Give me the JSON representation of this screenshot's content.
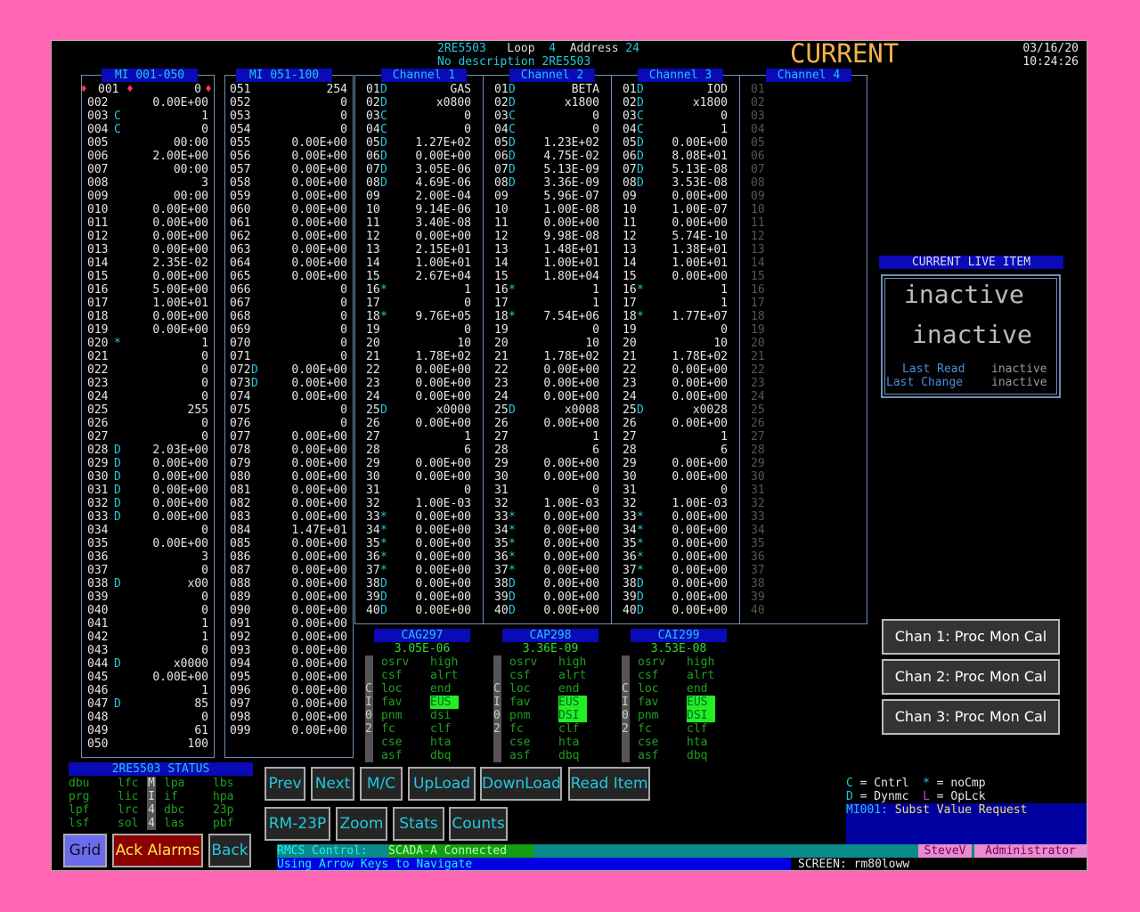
{
  "header": {
    "point": "2RE5503",
    "loop_label": "Loop",
    "loop": "4",
    "address_label": "Address",
    "address": "24",
    "description": "No description 2RE5503",
    "mode": "CURRENT",
    "date": "03/16/20",
    "time": "10:24:26"
  },
  "panels": {
    "mi1": "MI 001-050",
    "mi2": "MI 051-100",
    "ch1": "Channel 1",
    "ch2": "Channel 2",
    "ch3": "Channel 3",
    "ch4": "Channel 4"
  },
  "mi1": [
    [
      "001",
      "",
      "0"
    ],
    [
      "002",
      "",
      "0.00E+00"
    ],
    [
      "003",
      "C",
      "1"
    ],
    [
      "004",
      "C",
      "0"
    ],
    [
      "005",
      "",
      "00:00"
    ],
    [
      "006",
      "",
      "2.00E+00"
    ],
    [
      "007",
      "",
      "00:00"
    ],
    [
      "008",
      "",
      "3"
    ],
    [
      "009",
      "",
      "00:00"
    ],
    [
      "010",
      "",
      "0.00E+00"
    ],
    [
      "011",
      "",
      "0.00E+00"
    ],
    [
      "012",
      "",
      "0.00E+00"
    ],
    [
      "013",
      "",
      "0.00E+00"
    ],
    [
      "014",
      "",
      "2.35E-02"
    ],
    [
      "015",
      "",
      "0.00E+00"
    ],
    [
      "016",
      "",
      "5.00E+00"
    ],
    [
      "017",
      "",
      "1.00E+01"
    ],
    [
      "018",
      "",
      "0.00E+00"
    ],
    [
      "019",
      "",
      "0.00E+00"
    ],
    [
      "020",
      "*",
      "1"
    ],
    [
      "021",
      "",
      "0"
    ],
    [
      "022",
      "",
      "0"
    ],
    [
      "023",
      "",
      "0"
    ],
    [
      "024",
      "",
      "0"
    ],
    [
      "025",
      "",
      "255"
    ],
    [
      "026",
      "",
      "0"
    ],
    [
      "027",
      "",
      "0"
    ],
    [
      "028",
      "D",
      "2.03E+00"
    ],
    [
      "029",
      "D",
      "0.00E+00"
    ],
    [
      "030",
      "D",
      "0.00E+00"
    ],
    [
      "031",
      "D",
      "0.00E+00"
    ],
    [
      "032",
      "D",
      "0.00E+00"
    ],
    [
      "033",
      "D",
      "0.00E+00"
    ],
    [
      "034",
      "",
      "0"
    ],
    [
      "035",
      "",
      "0.00E+00"
    ],
    [
      "036",
      "",
      "3"
    ],
    [
      "037",
      "",
      "0"
    ],
    [
      "038",
      "D",
      "x00"
    ],
    [
      "039",
      "",
      "0"
    ],
    [
      "040",
      "",
      "0"
    ],
    [
      "041",
      "",
      "1"
    ],
    [
      "042",
      "",
      "1"
    ],
    [
      "043",
      "",
      "0"
    ],
    [
      "044",
      "D",
      "x0000"
    ],
    [
      "045",
      "",
      "0.00E+00"
    ],
    [
      "046",
      "",
      "1"
    ],
    [
      "047",
      "D",
      "85"
    ],
    [
      "048",
      "",
      "0"
    ],
    [
      "049",
      "",
      "61"
    ],
    [
      "050",
      "",
      "100"
    ]
  ],
  "mi2": [
    [
      "051",
      "",
      "254"
    ],
    [
      "052",
      "",
      "0"
    ],
    [
      "053",
      "",
      "0"
    ],
    [
      "054",
      "",
      "0"
    ],
    [
      "055",
      "",
      "0.00E+00"
    ],
    [
      "056",
      "",
      "0.00E+00"
    ],
    [
      "057",
      "",
      "0.00E+00"
    ],
    [
      "058",
      "",
      "0.00E+00"
    ],
    [
      "059",
      "",
      "0.00E+00"
    ],
    [
      "060",
      "",
      "0.00E+00"
    ],
    [
      "061",
      "",
      "0.00E+00"
    ],
    [
      "062",
      "",
      "0.00E+00"
    ],
    [
      "063",
      "",
      "0.00E+00"
    ],
    [
      "064",
      "",
      "0.00E+00"
    ],
    [
      "065",
      "",
      "0.00E+00"
    ],
    [
      "066",
      "",
      "0"
    ],
    [
      "067",
      "",
      "0"
    ],
    [
      "068",
      "",
      "0"
    ],
    [
      "069",
      "",
      "0"
    ],
    [
      "070",
      "",
      "0"
    ],
    [
      "071",
      "",
      "0"
    ],
    [
      "072",
      "D",
      "0.00E+00"
    ],
    [
      "073",
      "D",
      "0.00E+00"
    ],
    [
      "074",
      "",
      "0.00E+00"
    ],
    [
      "075",
      "",
      "0"
    ],
    [
      "076",
      "",
      "0"
    ],
    [
      "077",
      "",
      "0.00E+00"
    ],
    [
      "078",
      "",
      "0.00E+00"
    ],
    [
      "079",
      "",
      "0.00E+00"
    ],
    [
      "080",
      "",
      "0.00E+00"
    ],
    [
      "081",
      "",
      "0.00E+00"
    ],
    [
      "082",
      "",
      "0.00E+00"
    ],
    [
      "083",
      "",
      "0.00E+00"
    ],
    [
      "084",
      "",
      "1.47E+01"
    ],
    [
      "085",
      "",
      "0.00E+00"
    ],
    [
      "086",
      "",
      "0.00E+00"
    ],
    [
      "087",
      "",
      "0.00E+00"
    ],
    [
      "088",
      "",
      "0.00E+00"
    ],
    [
      "089",
      "",
      "0.00E+00"
    ],
    [
      "090",
      "",
      "0.00E+00"
    ],
    [
      "091",
      "",
      "0.00E+00"
    ],
    [
      "092",
      "",
      "0.00E+00"
    ],
    [
      "093",
      "",
      "0.00E+00"
    ],
    [
      "094",
      "",
      "0.00E+00"
    ],
    [
      "095",
      "",
      "0.00E+00"
    ],
    [
      "096",
      "",
      "0.00E+00"
    ],
    [
      "097",
      "",
      "0.00E+00"
    ],
    [
      "098",
      "",
      "0.00E+00"
    ],
    [
      "099",
      "",
      "0.00E+00"
    ]
  ],
  "ch1": [
    [
      "01",
      "D",
      "GAS"
    ],
    [
      "02",
      "D",
      "x0800"
    ],
    [
      "03",
      "C",
      "0"
    ],
    [
      "04",
      "C",
      "0"
    ],
    [
      "05",
      "D",
      "1.27E+02"
    ],
    [
      "06",
      "D",
      "0.00E+00"
    ],
    [
      "07",
      "D",
      "3.05E-06"
    ],
    [
      "08",
      "D",
      "4.69E-06"
    ],
    [
      "09",
      "",
      "2.00E-04"
    ],
    [
      "10",
      "",
      "9.14E-06"
    ],
    [
      "11",
      "",
      "3.40E-08"
    ],
    [
      "12",
      "",
      "0.00E+00"
    ],
    [
      "13",
      "",
      "2.15E+01"
    ],
    [
      "14",
      "",
      "1.00E+01"
    ],
    [
      "15",
      "",
      "2.67E+04"
    ],
    [
      "16",
      "*",
      "1"
    ],
    [
      "17",
      "",
      "0"
    ],
    [
      "18",
      "*",
      "9.76E+05"
    ],
    [
      "19",
      "",
      "0"
    ],
    [
      "20",
      "",
      "10"
    ],
    [
      "21",
      "",
      "1.78E+02"
    ],
    [
      "22",
      "",
      "0.00E+00"
    ],
    [
      "23",
      "",
      "0.00E+00"
    ],
    [
      "24",
      "",
      "0.00E+00"
    ],
    [
      "25",
      "D",
      "x0000"
    ],
    [
      "26",
      "",
      "0.00E+00"
    ],
    [
      "27",
      "",
      "1"
    ],
    [
      "28",
      "",
      "6"
    ],
    [
      "29",
      "",
      "0.00E+00"
    ],
    [
      "30",
      "",
      "0.00E+00"
    ],
    [
      "31",
      "",
      "0"
    ],
    [
      "32",
      "",
      "1.00E-03"
    ],
    [
      "33",
      "*",
      "0.00E+00"
    ],
    [
      "34",
      "*",
      "0.00E+00"
    ],
    [
      "35",
      "*",
      "0.00E+00"
    ],
    [
      "36",
      "*",
      "0.00E+00"
    ],
    [
      "37",
      "*",
      "0.00E+00"
    ],
    [
      "38",
      "D",
      "0.00E+00"
    ],
    [
      "39",
      "D",
      "0.00E+00"
    ],
    [
      "40",
      "D",
      "0.00E+00"
    ]
  ],
  "ch2": [
    [
      "01",
      "D",
      "BETA"
    ],
    [
      "02",
      "D",
      "x1800"
    ],
    [
      "03",
      "C",
      "0"
    ],
    [
      "04",
      "C",
      "0"
    ],
    [
      "05",
      "D",
      "1.23E+02"
    ],
    [
      "06",
      "D",
      "4.75E-02"
    ],
    [
      "07",
      "D",
      "5.13E-09"
    ],
    [
      "08",
      "D",
      "3.36E-09"
    ],
    [
      "09",
      "",
      "5.96E-07"
    ],
    [
      "10",
      "",
      "1.00E-08"
    ],
    [
      "11",
      "",
      "0.00E+00"
    ],
    [
      "12",
      "",
      "9.98E-08"
    ],
    [
      "13",
      "",
      "1.48E+01"
    ],
    [
      "14",
      "",
      "1.00E+01"
    ],
    [
      "15",
      "",
      "1.80E+04"
    ],
    [
      "16",
      "*",
      "1"
    ],
    [
      "17",
      "",
      "1"
    ],
    [
      "18",
      "*",
      "7.54E+06"
    ],
    [
      "19",
      "",
      "0"
    ],
    [
      "20",
      "",
      "10"
    ],
    [
      "21",
      "",
      "1.78E+02"
    ],
    [
      "22",
      "",
      "0.00E+00"
    ],
    [
      "23",
      "",
      "0.00E+00"
    ],
    [
      "24",
      "",
      "0.00E+00"
    ],
    [
      "25",
      "D",
      "x0008"
    ],
    [
      "26",
      "",
      "0.00E+00"
    ],
    [
      "27",
      "",
      "1"
    ],
    [
      "28",
      "",
      "6"
    ],
    [
      "29",
      "",
      "0.00E+00"
    ],
    [
      "30",
      "",
      "0.00E+00"
    ],
    [
      "31",
      "",
      "0"
    ],
    [
      "32",
      "",
      "1.00E-03"
    ],
    [
      "33",
      "*",
      "0.00E+00"
    ],
    [
      "34",
      "*",
      "0.00E+00"
    ],
    [
      "35",
      "*",
      "0.00E+00"
    ],
    [
      "36",
      "*",
      "0.00E+00"
    ],
    [
      "37",
      "*",
      "0.00E+00"
    ],
    [
      "38",
      "D",
      "0.00E+00"
    ],
    [
      "39",
      "D",
      "0.00E+00"
    ],
    [
      "40",
      "D",
      "0.00E+00"
    ]
  ],
  "ch3": [
    [
      "01",
      "D",
      "IOD"
    ],
    [
      "02",
      "D",
      "x1800"
    ],
    [
      "03",
      "C",
      "0"
    ],
    [
      "04",
      "C",
      "1"
    ],
    [
      "05",
      "D",
      "0.00E+00"
    ],
    [
      "06",
      "D",
      "8.08E+01"
    ],
    [
      "07",
      "D",
      "5.13E-08"
    ],
    [
      "08",
      "D",
      "3.53E-08"
    ],
    [
      "09",
      "",
      "0.00E+00"
    ],
    [
      "10",
      "",
      "1.00E-07"
    ],
    [
      "11",
      "",
      "0.00E+00"
    ],
    [
      "12",
      "",
      "5.74E-10"
    ],
    [
      "13",
      "",
      "1.38E+01"
    ],
    [
      "14",
      "",
      "1.00E+01"
    ],
    [
      "15",
      "",
      "0.00E+00"
    ],
    [
      "16",
      "*",
      "1"
    ],
    [
      "17",
      "",
      "1"
    ],
    [
      "18",
      "*",
      "1.77E+07"
    ],
    [
      "19",
      "",
      "0"
    ],
    [
      "20",
      "",
      "10"
    ],
    [
      "21",
      "",
      "1.78E+02"
    ],
    [
      "22",
      "",
      "0.00E+00"
    ],
    [
      "23",
      "",
      "0.00E+00"
    ],
    [
      "24",
      "",
      "0.00E+00"
    ],
    [
      "25",
      "D",
      "x0028"
    ],
    [
      "26",
      "",
      "0.00E+00"
    ],
    [
      "27",
      "",
      "1"
    ],
    [
      "28",
      "",
      "6"
    ],
    [
      "29",
      "",
      "0.00E+00"
    ],
    [
      "30",
      "",
      "0.00E+00"
    ],
    [
      "31",
      "",
      "0"
    ],
    [
      "32",
      "",
      "1.00E-03"
    ],
    [
      "33",
      "*",
      "0.00E+00"
    ],
    [
      "34",
      "*",
      "0.00E+00"
    ],
    [
      "35",
      "*",
      "0.00E+00"
    ],
    [
      "36",
      "*",
      "0.00E+00"
    ],
    [
      "37",
      "*",
      "0.00E+00"
    ],
    [
      "38",
      "D",
      "0.00E+00"
    ],
    [
      "39",
      "D",
      "0.00E+00"
    ],
    [
      "40",
      "D",
      "0.00E+00"
    ]
  ],
  "ch4": [
    "01",
    "02",
    "03",
    "04",
    "05",
    "06",
    "07",
    "08",
    "09",
    "10",
    "11",
    "12",
    "13",
    "14",
    "15",
    "16",
    "17",
    "18",
    "19",
    "20",
    "21",
    "22",
    "23",
    "24",
    "25",
    "26",
    "27",
    "28",
    "29",
    "30",
    "31",
    "32",
    "33",
    "34",
    "35",
    "36",
    "37",
    "38",
    "39",
    "40"
  ],
  "live_item": {
    "title": "CURRENT LIVE ITEM",
    "line1": "inactive",
    "line2": "inactive",
    "last_read_label": "Last Read",
    "last_read": "inactive",
    "last_change_label": "Last Change",
    "last_change": "inactive"
  },
  "cal_buttons": [
    "Chan 1:  Proc Mon Cal",
    "Chan 2:  Proc Mon Cal",
    "Chan 3:  Proc Mon Cal"
  ],
  "monitors": [
    {
      "name": "CAG297",
      "value": "3.05E-06",
      "side": [
        "C",
        "I",
        "0",
        "2"
      ]
    },
    {
      "name": "CAP298",
      "value": "3.36E-09",
      "side": [
        "C",
        "I",
        "0",
        "2"
      ]
    },
    {
      "name": "CAI299",
      "value": "3.53E-08",
      "side": [
        "C",
        "I",
        "0",
        "2"
      ]
    }
  ],
  "flags": {
    "col1": [
      "osrv",
      "csf",
      "loc",
      "fav",
      "pnm",
      "fc",
      "cse",
      "asf"
    ],
    "col2": [
      "high",
      "alrt",
      "end",
      "EUS",
      "dsi",
      "clf",
      "hta",
      "dbq"
    ],
    "lit_fav": [
      "EUS",
      "EUS",
      "EUS"
    ],
    "lit_dsi": [
      "dsi",
      "DSI",
      "DSI"
    ]
  },
  "status": {
    "title": "2RE5503 STATUS",
    "c1": [
      "dbu",
      "prg",
      "lpf",
      "lsf"
    ],
    "c2": [
      "lfc",
      "lic",
      "lrc",
      "sol"
    ],
    "c3": [
      "M",
      "I",
      "4",
      "4"
    ],
    "c4": [
      "lpa",
      "if",
      "dbc",
      "las"
    ],
    "c5": [
      "lbs",
      "hpa",
      "23p",
      "pbf"
    ]
  },
  "buttons": {
    "prev": "Prev",
    "next": "Next",
    "mc": "M/C",
    "upload": "UpLoad",
    "download": "DownLoad",
    "read_item": "Read Item",
    "rm23p": "RM-23P",
    "zoom": "Zoom",
    "stats": "Stats",
    "counts": "Counts",
    "grid": "Grid",
    "ack": "Ack Alarms",
    "back": "Back"
  },
  "legend": {
    "c": "C",
    "c_text": " = Cntrl",
    "star": "*",
    "star_text": " = noCmp",
    "d": "D",
    "d_text": " = Dynmc",
    "l": "L",
    "l_text": " = OpLck"
  },
  "message": {
    "label": "MI001:",
    "text": "Subst Value Request"
  },
  "statusbar": {
    "label": "RMCS Control:",
    "conn": "SCADA-A Connected",
    "user": "SteveV",
    "role": "Administrator",
    "hint": "Using Arrow Keys to Navigate",
    "screen_label": "SCREEN:",
    "screen": "rm80loww"
  },
  "colors": {
    "background": "#ff66b2",
    "cyan": "#22c8dd",
    "header_blue": "#0a0ab8",
    "alarm_red": "#8b0000",
    "lit_green": "#22ee22"
  }
}
